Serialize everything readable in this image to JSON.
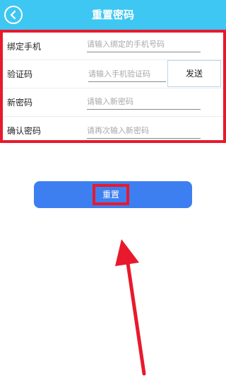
{
  "header": {
    "title": "重置密码",
    "back_icon": "chevron-left-icon",
    "background": "#3ec7f2"
  },
  "form": {
    "phone": {
      "label": "绑定手机",
      "placeholder": "请输入绑定的手机号码",
      "value": ""
    },
    "code": {
      "label": "验证码",
      "placeholder": "请输入手机验证码",
      "value": "",
      "send_label": "发送"
    },
    "new_password": {
      "label": "新密码",
      "placeholder": "请输入新密码",
      "value": ""
    },
    "confirm_password": {
      "label": "确认密码",
      "placeholder": "请再次输入新密码",
      "value": ""
    }
  },
  "reset_button": {
    "label": "重置",
    "color": "#3d7ff0"
  },
  "annotation": {
    "highlight_color": "#e8192c",
    "arrow": "arrow-up-icon"
  }
}
